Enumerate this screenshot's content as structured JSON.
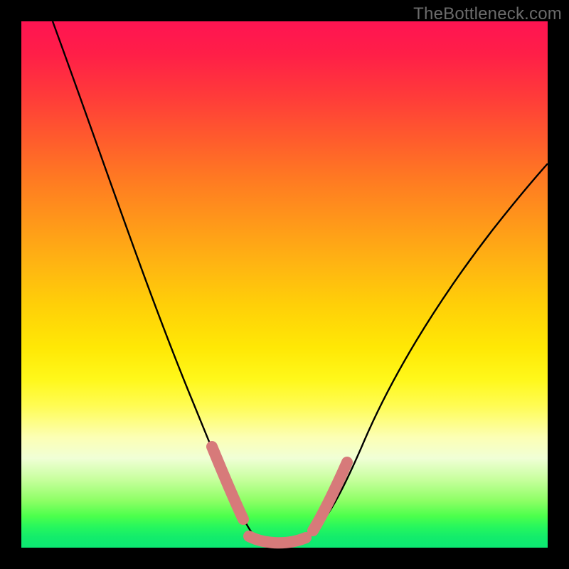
{
  "watermark": "TheBottleneck.com",
  "colors": {
    "frame": "#000000",
    "watermark": "#6b6b6b",
    "curve": "#000000",
    "marker": "#d77a7a"
  },
  "chart_data": {
    "type": "line",
    "title": "",
    "xlabel": "",
    "ylabel": "",
    "xlim": [
      0,
      100
    ],
    "ylim": [
      0,
      100
    ],
    "grid": false,
    "legend": false,
    "annotations": [],
    "series": [
      {
        "name": "bottleneck-curve",
        "x": [
          6,
          10,
          15,
          20,
          25,
          30,
          33,
          36,
          39,
          41,
          43,
          45,
          48,
          52,
          55,
          58,
          62,
          68,
          75,
          82,
          90,
          100
        ],
        "y": [
          100,
          89,
          76,
          63,
          50,
          37,
          28,
          20,
          12,
          7,
          4,
          2,
          1,
          1,
          2,
          5,
          10,
          18,
          28,
          38,
          49,
          62
        ]
      }
    ],
    "markers": [
      {
        "name": "left-descent-marker",
        "x_range": [
          36,
          43
        ],
        "y_range": [
          20,
          4
        ]
      },
      {
        "name": "valley-floor-marker",
        "x_range": [
          43,
          55
        ],
        "y_range": [
          4,
          2
        ]
      },
      {
        "name": "right-ascent-marker",
        "x_range": [
          55,
          62
        ],
        "y_range": [
          2,
          10
        ]
      }
    ]
  }
}
